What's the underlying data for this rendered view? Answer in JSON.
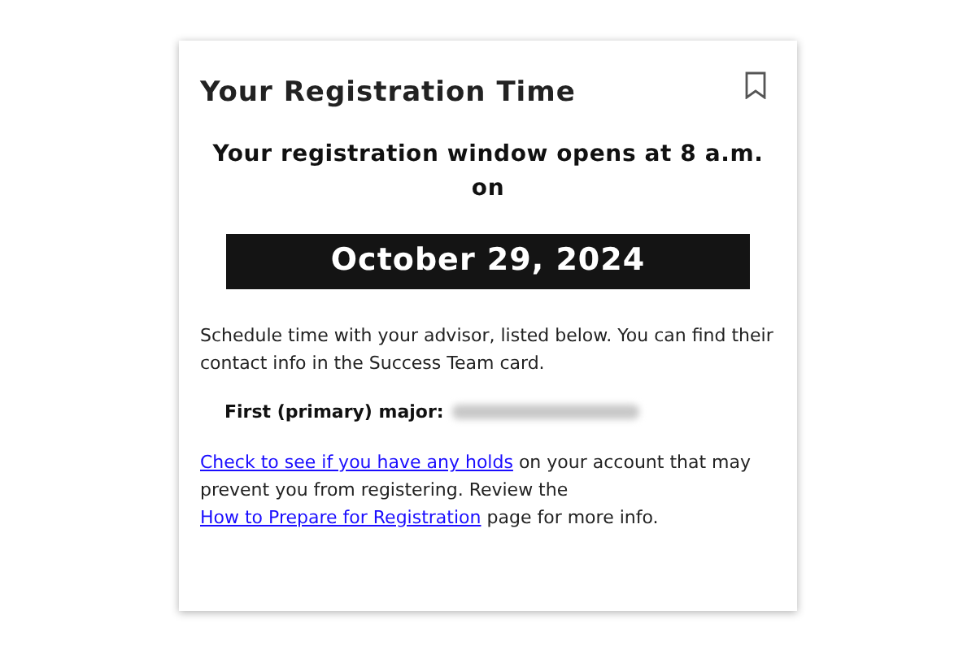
{
  "card": {
    "title": "Your Registration Time",
    "bookmarked": false,
    "lead": "Your registration window opens at 8 a.m. on",
    "date": "October 29, 2024",
    "intro": "Schedule time with your advisor, listed below. You can find their contact info in the Success Team card.",
    "major_label": "First (primary) major:",
    "major_value": {
      "kind": "redacted"
    },
    "note": [
      {
        "kind": "link",
        "text": "Check to see if you have any holds"
      },
      {
        "kind": "text",
        "text": " on your account that may prevent you from registering. Review the "
      },
      {
        "kind": "link",
        "text": "How to Prepare for Registration"
      },
      {
        "kind": "text",
        "text": " page for more info."
      }
    ]
  }
}
